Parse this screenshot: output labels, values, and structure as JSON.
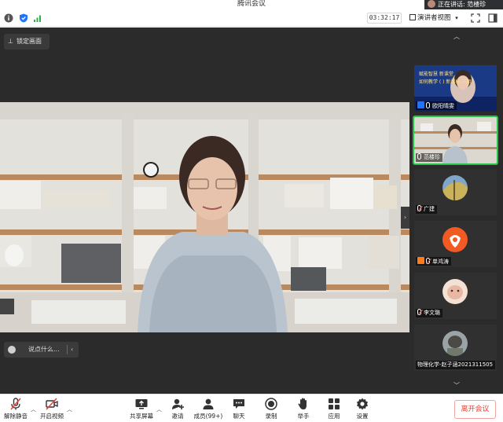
{
  "window": {
    "title": "腾讯会议",
    "speaking_prefix": "正在讲话: ",
    "speaking_name": "范楼珍"
  },
  "toolbar": {
    "timer": "03:32:17",
    "view_label": "演讲者视图"
  },
  "stage": {
    "lock_label": "锁定画面",
    "chat_placeholder": "说点什么..."
  },
  "participants": [
    {
      "name": "欧阳晴雯",
      "mic": "on",
      "badge": "user-blue",
      "kind": "slide"
    },
    {
      "name": "范楼珍",
      "mic": "on",
      "badge": "none",
      "kind": "camera",
      "active": true
    },
    {
      "name": "广建",
      "mic": "muted",
      "badge": "none",
      "kind": "avatar"
    },
    {
      "name": "单鸿涛",
      "mic": "muted",
      "badge": "user-orange",
      "kind": "avatar"
    },
    {
      "name": "李文璐",
      "mic": "muted",
      "badge": "none",
      "kind": "avatar"
    },
    {
      "name": "物理化学-赵子涵2021311505",
      "mic": "none",
      "badge": "none",
      "kind": "avatar"
    }
  ],
  "slide_banner": {
    "line1": "赋能智慧 新课堂",
    "line2": "如何教学 ( )  新课标 三期"
  },
  "bottom": {
    "mute": "解除静音",
    "video": "开启视频",
    "share": "共享屏幕",
    "invite": "邀请",
    "members": "成员(99+)",
    "chat": "聊天",
    "record": "录制",
    "raise": "举手",
    "apps": "应用",
    "settings": "设置",
    "leave": "离开会议"
  },
  "colors": {
    "active_border": "#27c245",
    "leave_red": "#e8453c",
    "stage_bg": "#2b2b2b",
    "signal_green": "#2ab24b",
    "shield_blue": "#1e74ff"
  }
}
